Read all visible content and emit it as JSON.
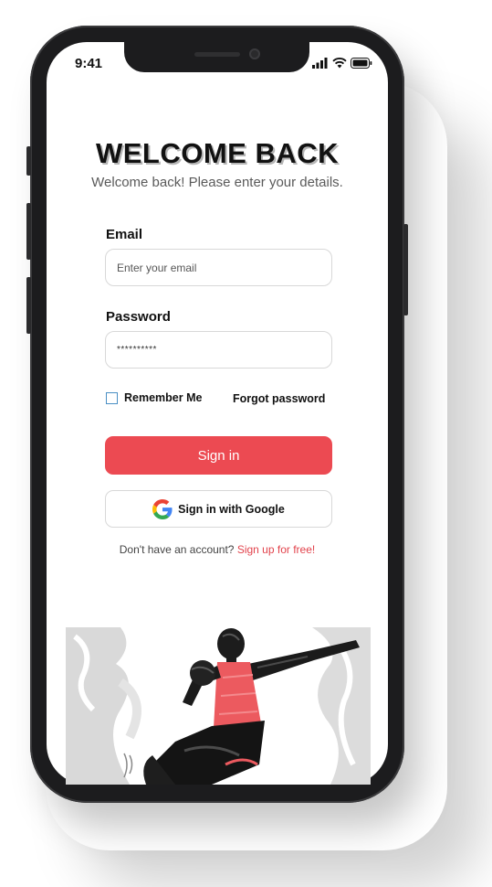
{
  "status": {
    "time": "9:41"
  },
  "login": {
    "title": "WELCOME BACK",
    "subtitle": "Welcome back! Please enter your details.",
    "email_label": "Email",
    "email_placeholder": "Enter your email",
    "password_label": "Password",
    "password_value": "**********",
    "remember_label": "Remember Me",
    "forgot_label": "Forgot password",
    "signin_label": "Sign in",
    "google_label": "Sign in with Google",
    "signup_prompt": "Don't have an account?",
    "signup_link": "Sign up for free!"
  },
  "colors": {
    "accent": "#ec4a52",
    "link": "#e2434c",
    "checkbox": "#4a8fc4"
  },
  "icons": [
    "signal-icon",
    "wifi-icon",
    "battery-icon",
    "google-icon",
    "checkbox-icon"
  ]
}
